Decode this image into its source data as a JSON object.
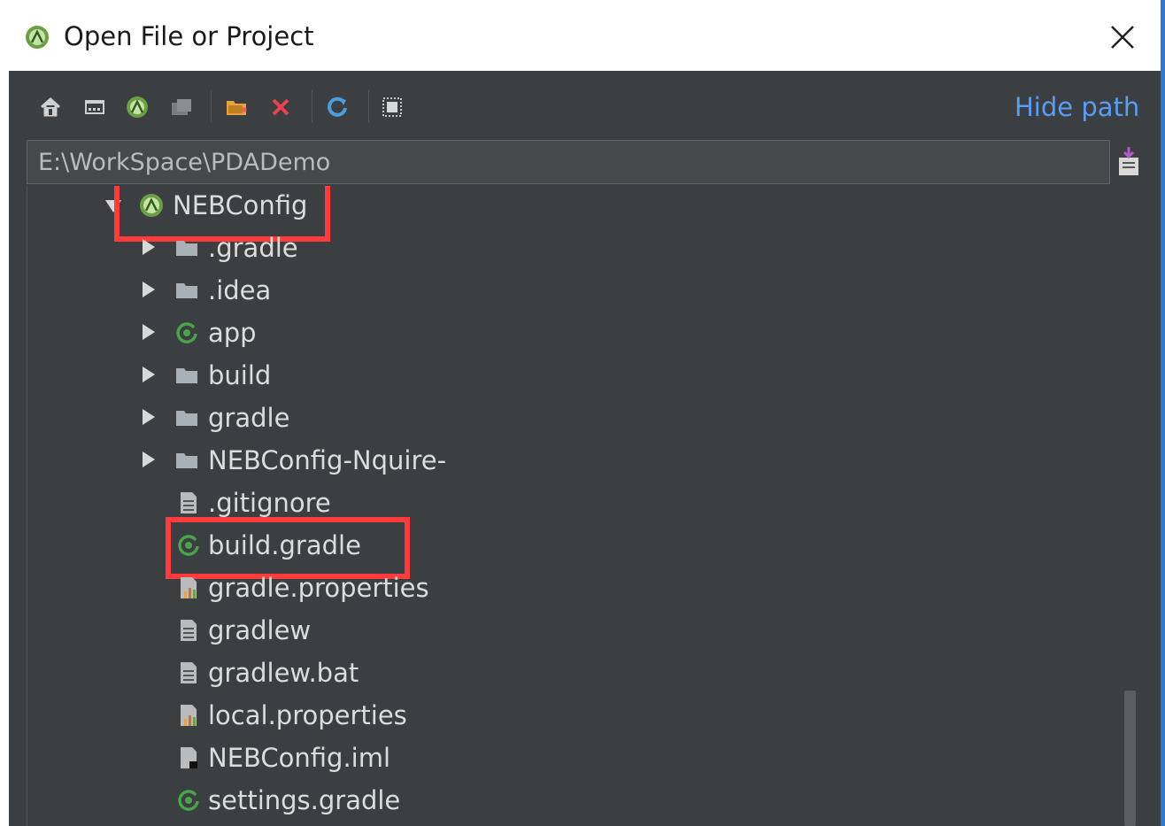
{
  "window": {
    "title": "Open File or Project",
    "close_icon": "close-icon",
    "accent_color": "#2b79d4"
  },
  "toolbar": {
    "buttons": [
      {
        "name": "home-icon"
      },
      {
        "name": "desktop-icon"
      },
      {
        "name": "android-project-icon"
      },
      {
        "name": "module-folder-icon"
      },
      {
        "name": "new-folder-icon"
      },
      {
        "name": "delete-icon"
      },
      {
        "name": "refresh-icon"
      },
      {
        "name": "show-hidden-icon"
      }
    ],
    "hide_path_label": "Hide path"
  },
  "path": {
    "value": "E:\\WorkSpace\\PDADemo"
  },
  "tree": {
    "root": {
      "label": "NEBConfig",
      "icon": "android-icon",
      "expanded": true,
      "highlighted": true
    },
    "items": [
      {
        "label": ".gradle",
        "icon": "folder-icon",
        "expandable": true
      },
      {
        "label": ".idea",
        "icon": "folder-icon",
        "expandable": true
      },
      {
        "label": "app",
        "icon": "gradle-module-icon",
        "expandable": true
      },
      {
        "label": "build",
        "icon": "folder-icon",
        "expandable": true
      },
      {
        "label": "gradle",
        "icon": "folder-icon",
        "expandable": true
      },
      {
        "label": "NEBConfig-Nquire-",
        "icon": "folder-icon",
        "expandable": true
      },
      {
        "label": ".gitignore",
        "icon": "text-file-icon",
        "expandable": false
      },
      {
        "label": "build.gradle",
        "icon": "gradle-file-icon",
        "expandable": false,
        "highlighted": true
      },
      {
        "label": "gradle.properties",
        "icon": "properties-file-icon",
        "expandable": false
      },
      {
        "label": "gradlew",
        "icon": "text-file-icon",
        "expandable": false
      },
      {
        "label": "gradlew.bat",
        "icon": "text-file-icon",
        "expandable": false
      },
      {
        "label": "local.properties",
        "icon": "properties-file-icon",
        "expandable": false
      },
      {
        "label": "NEBConfig.iml",
        "icon": "iml-file-icon",
        "expandable": false
      },
      {
        "label": "settings.gradle",
        "icon": "gradle-file-icon",
        "expandable": false
      }
    ]
  },
  "colors": {
    "background": "#3c3f41",
    "text": "#dcdcdc",
    "link": "#589df6",
    "highlight_box": "#ff3b3b"
  }
}
